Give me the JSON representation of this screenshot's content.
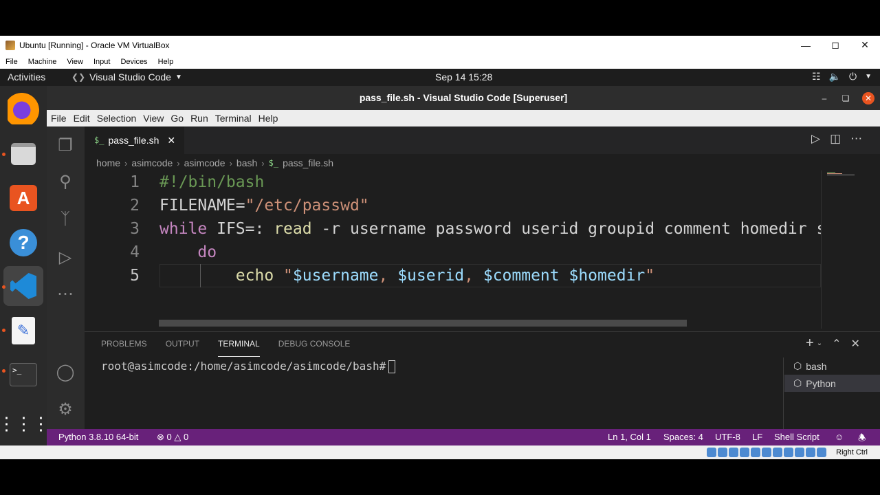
{
  "vbox": {
    "title": "Ubuntu [Running] - Oracle VM VirtualBox",
    "menu": [
      "File",
      "Machine",
      "View",
      "Input",
      "Devices",
      "Help"
    ],
    "minimize_icon": "minimize-icon",
    "maximize_icon": "maximize-icon",
    "close_icon": "close-icon",
    "host_key": "Right Ctrl"
  },
  "gnome": {
    "activities": "Activities",
    "app_menu": "Visual Studio Code",
    "clock": "Sep 14  15:28"
  },
  "dock": {
    "items": [
      "firefox-icon",
      "files-icon",
      "software-center-icon",
      "help-icon",
      "vscode-icon",
      "text-editor-icon",
      "terminal-icon",
      "app-grid-icon"
    ]
  },
  "vscode": {
    "title": "pass_file.sh - Visual Studio Code [Superuser]",
    "menu": [
      "File",
      "Edit",
      "Selection",
      "View",
      "Go",
      "Run",
      "Terminal",
      "Help"
    ],
    "tab": {
      "label": "pass_file.sh",
      "icon": "$_"
    },
    "breadcrumb": [
      "home",
      "asimcode",
      "asimcode",
      "bash",
      "pass_file.sh"
    ],
    "code": [
      {
        "n": "1",
        "parts": [
          {
            "t": "#!/bin/bash",
            "c": "#6a9955"
          }
        ]
      },
      {
        "n": "2",
        "parts": [
          {
            "t": "FILENAME=",
            "c": "#d4d4d4"
          },
          {
            "t": "\"/etc/passwd\"",
            "c": "#ce9178"
          }
        ]
      },
      {
        "n": "3",
        "parts": [
          {
            "t": "while",
            "c": "#c586c0"
          },
          {
            "t": " IFS=: ",
            "c": "#d4d4d4"
          },
          {
            "t": "read",
            "c": "#dcdcaa"
          },
          {
            "t": " -r username password userid groupid comment homedir shell",
            "c": "#d4d4d4"
          }
        ]
      },
      {
        "n": "4",
        "parts": [
          {
            "t": "    ",
            "c": "#d4d4d4"
          },
          {
            "t": "do",
            "c": "#c586c0"
          }
        ]
      },
      {
        "n": "5",
        "parts": [
          {
            "t": "        ",
            "c": "#d4d4d4"
          },
          {
            "t": "echo",
            "c": "#dcdcaa"
          },
          {
            "t": " \"",
            "c": "#ce9178"
          },
          {
            "t": "$username",
            "c": "#9cdcfe"
          },
          {
            "t": ", ",
            "c": "#ce9178"
          },
          {
            "t": "$userid",
            "c": "#9cdcfe"
          },
          {
            "t": ", ",
            "c": "#ce9178"
          },
          {
            "t": "$comment",
            "c": "#9cdcfe"
          },
          {
            "t": " ",
            "c": "#ce9178"
          },
          {
            "t": "$homedir",
            "c": "#9cdcfe"
          },
          {
            "t": "\"",
            "c": "#ce9178"
          }
        ]
      }
    ],
    "current_line": "5",
    "panel": {
      "tabs": [
        "PROBLEMS",
        "OUTPUT",
        "TERMINAL",
        "DEBUG CONSOLE"
      ],
      "active_tab": "TERMINAL",
      "prompt": "root@asimcode:/home/asimcode/asimcode/bash#",
      "terminals": [
        "bash",
        "Python"
      ],
      "selected_terminal": "Python"
    },
    "status": {
      "interpreter": "Python 3.8.10 64-bit",
      "errors": "0",
      "warnings": "0",
      "position": "Ln 1, Col 1",
      "spaces": "Spaces: 4",
      "encoding": "UTF-8",
      "eol": "LF",
      "language": "Shell Script"
    },
    "colors": {
      "statusbar": "#68217a",
      "editor_bg": "#1e1e1e"
    }
  }
}
